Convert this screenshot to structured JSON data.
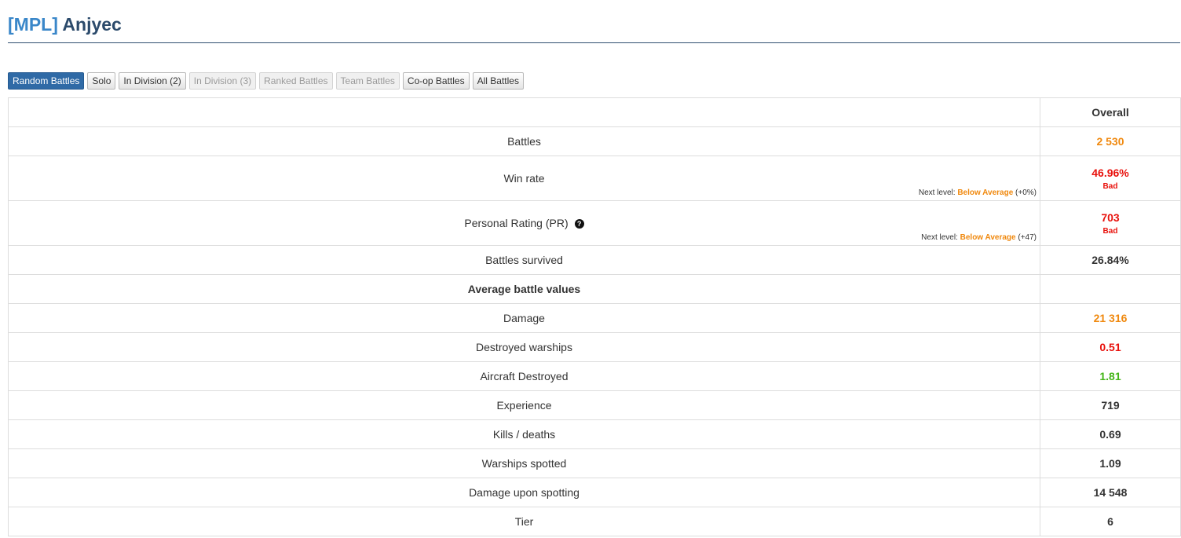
{
  "header": {
    "clan_tag": "[MPL]",
    "player_name": "Anjyec"
  },
  "tabs": [
    {
      "label": "Random Battles",
      "state": "active"
    },
    {
      "label": "Solo",
      "state": "enabled"
    },
    {
      "label": "In Division (2)",
      "state": "enabled"
    },
    {
      "label": "In Division (3)",
      "state": "disabled"
    },
    {
      "label": "Ranked Battles",
      "state": "disabled"
    },
    {
      "label": "Team Battles",
      "state": "disabled"
    },
    {
      "label": "Co-op Battles",
      "state": "enabled"
    },
    {
      "label": "All Battles",
      "state": "enabled"
    }
  ],
  "table": {
    "column_header": "Overall",
    "battles": {
      "label": "Battles",
      "value": "2 530",
      "color": "#f0890f"
    },
    "win_rate": {
      "label": "Win rate",
      "value": "46.96%",
      "rating": "Bad",
      "color": "#e8110c",
      "next_prefix": "Next level:",
      "next_level": "Below Average",
      "next_delta": "(+0%)"
    },
    "personal_rating": {
      "label": "Personal Rating (PR)",
      "help_icon": "?",
      "value": "703",
      "rating": "Bad",
      "color": "#e8110c",
      "next_prefix": "Next level:",
      "next_level": "Below Average",
      "next_delta": "(+47)"
    },
    "survived": {
      "label": "Battles survived",
      "value": "26.84%",
      "color": "#333333"
    },
    "avg_heading": "Average battle values",
    "avg_rows": [
      {
        "label": "Damage",
        "value": "21 316",
        "color": "#f0890f"
      },
      {
        "label": "Destroyed warships",
        "value": "0.51",
        "color": "#e8110c"
      },
      {
        "label": "Aircraft Destroyed",
        "value": "1.81",
        "color": "#44b518"
      },
      {
        "label": "Experience",
        "value": "719",
        "color": "#333333"
      },
      {
        "label": "Kills / deaths",
        "value": "0.69",
        "color": "#333333"
      },
      {
        "label": "Warships spotted",
        "value": "1.09",
        "color": "#333333"
      },
      {
        "label": "Damage upon spotting",
        "value": "14 548",
        "color": "#333333"
      },
      {
        "label": "Tier",
        "value": "6",
        "color": "#333333"
      }
    ]
  }
}
